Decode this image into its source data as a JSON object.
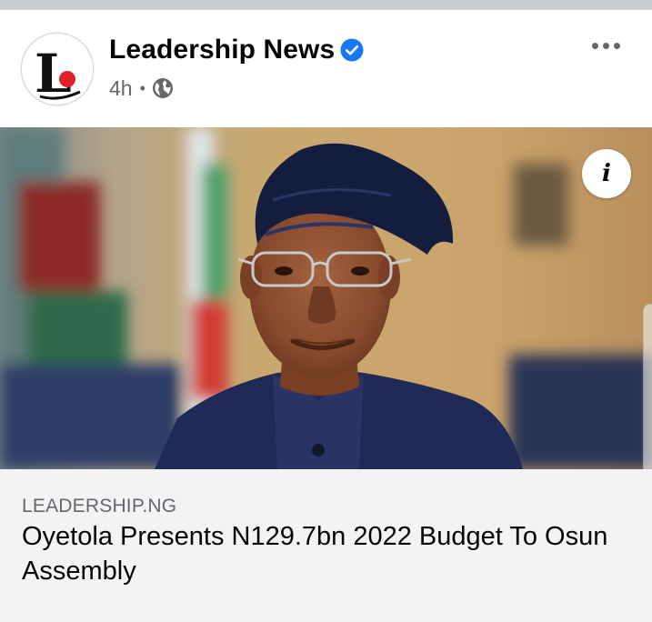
{
  "post": {
    "page_name": "Leadership News",
    "avatar_letter": "L",
    "time": "4h",
    "separator": "•",
    "verified": true,
    "audience_icon": "globe-icon",
    "more_icon": "more-options-icon"
  },
  "link_preview": {
    "domain": "LEADERSHIP.NG",
    "headline": "Oyetola Presents N129.7bn 2022 Budget To Osun Assembly",
    "info_label": "i"
  },
  "colors": {
    "verified_blue": "#1877f2",
    "avatar_red": "#e0202d",
    "secondary_text": "#65676b",
    "link_box_bg": "#f2f3f5"
  }
}
